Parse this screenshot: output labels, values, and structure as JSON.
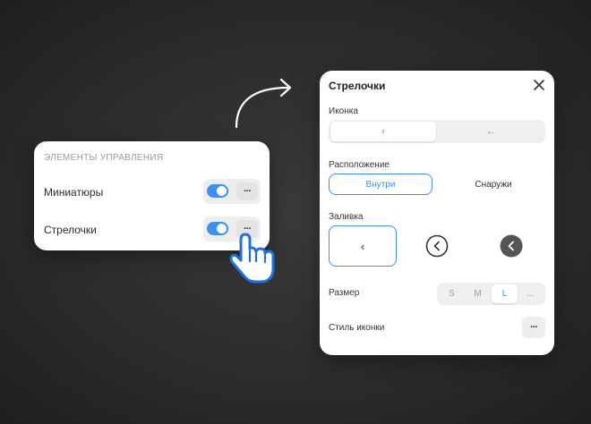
{
  "left_panel": {
    "header": "ЭЛЕМЕНТЫ УПРАВЛЕНИЯ",
    "rows": [
      {
        "label": "Миниатюры",
        "toggle_on": true,
        "more_label": "···"
      },
      {
        "label": "Стрелочки",
        "toggle_on": true,
        "more_label": "···"
      }
    ]
  },
  "right_panel": {
    "title": "Стрелочки",
    "icon_section": {
      "label": "Иконка",
      "options": [
        {
          "glyph": "‹",
          "selected": true,
          "icon": "chevron-left-icon"
        },
        {
          "glyph": "←",
          "selected": false,
          "icon": "arrow-left-icon"
        }
      ]
    },
    "position_section": {
      "label": "Расположение",
      "options": [
        {
          "label": "Внутри",
          "selected": true
        },
        {
          "label": "Снаружи",
          "selected": false
        }
      ]
    },
    "fill_section": {
      "label": "Заливка",
      "options": [
        {
          "glyph": "‹",
          "style": "plain",
          "selected": true
        },
        {
          "style": "outline",
          "selected": false
        },
        {
          "style": "solid",
          "selected": false
        }
      ]
    },
    "size_section": {
      "label": "Размер",
      "options": [
        "S",
        "M",
        "L",
        "..."
      ],
      "selected": "L"
    },
    "icon_style_section": {
      "label": "Стиль иконки",
      "more_label": "···"
    }
  },
  "colors": {
    "accent": "#3d8ef5",
    "panel_bg": "#ffffff",
    "page_bg": "#2c2c2c"
  }
}
